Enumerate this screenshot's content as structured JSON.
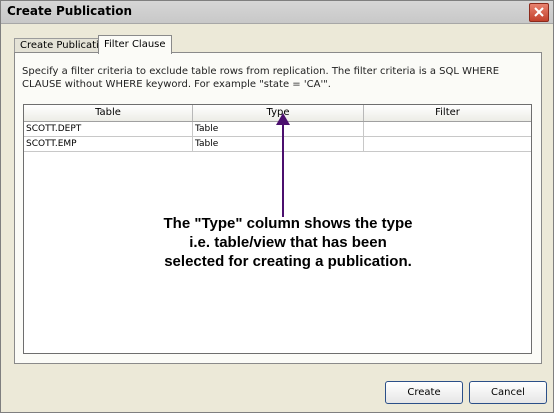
{
  "window": {
    "title": "Create Publication"
  },
  "tabs": [
    {
      "label": "Create Publication",
      "active": false
    },
    {
      "label": "Filter Clause",
      "active": true
    }
  ],
  "description": "Specify a filter criteria to exclude table rows from replication. The filter criteria is a SQL WHERE CLAUSE without WHERE keyword. For example \"state = 'CA'\".",
  "table": {
    "columns": [
      "Table",
      "Type",
      "Filter"
    ],
    "rows": [
      {
        "table": "SCOTT.DEPT",
        "type": "Table",
        "filter": ""
      },
      {
        "table": "SCOTT.EMP",
        "type": "Table",
        "filter": ""
      }
    ]
  },
  "annotation": {
    "line1": "The \"Type\" column shows the type",
    "line2": "i.e. table/view that has been",
    "line3": "selected for creating a publication.",
    "arrow_color": "#4b0f6e"
  },
  "buttons": {
    "create": "Create",
    "cancel": "Cancel"
  }
}
